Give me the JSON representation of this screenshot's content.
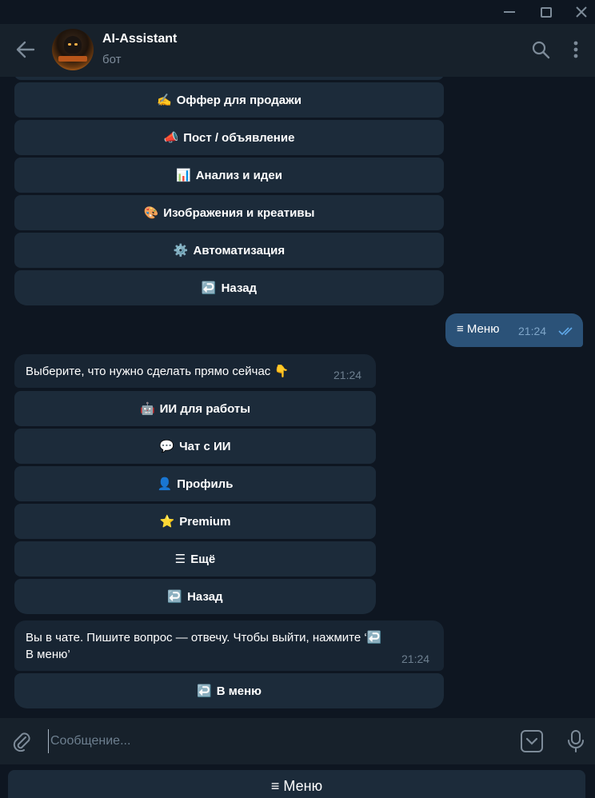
{
  "window": {
    "minimize_label": "—",
    "maximize_label": "☐",
    "close_label": "✕"
  },
  "header": {
    "title": "AI-Assistant",
    "subtitle": "бот"
  },
  "colors": {
    "accent": "#2b5278",
    "bg": "#0e1621",
    "panel": "#17212b",
    "button": "#1c2b3a",
    "read_checks": "#5fa8e8"
  },
  "keyboard_top": [
    {
      "emoji": "✍️",
      "label": "Оффер для продажи"
    },
    {
      "emoji": "📣",
      "label": "Пост / объявление"
    },
    {
      "emoji": "📊",
      "label": "Анализ и идеи"
    },
    {
      "emoji": "🎨",
      "label": "Изображения и креативы"
    },
    {
      "emoji": "⚙️",
      "label": "Автоматизация"
    },
    {
      "emoji": "↩️",
      "label": "Назад"
    }
  ],
  "outgoing": {
    "text": "≡ Меню",
    "time": "21:24"
  },
  "message1": {
    "text": "Выберите, что нужно сделать прямо сейчас 👇",
    "time": "21:24"
  },
  "keyboard_mid": [
    {
      "emoji": "🤖",
      "label": "ИИ для работы"
    },
    {
      "emoji": "💬",
      "label": "Чат с ИИ"
    },
    {
      "emoji": "👤",
      "label": "Профиль"
    },
    {
      "emoji": "⭐",
      "label": "Premium"
    },
    {
      "emoji": "☰",
      "label": "Ещё"
    },
    {
      "emoji": "↩️",
      "label": "Назад"
    }
  ],
  "message2": {
    "line1": "Вы в чате. Пишите вопрос — отвечу. Чтобы выйти, нажмите ‘↩️",
    "line2": "В меню’",
    "time": "21:24"
  },
  "keyboard_bottom": [
    {
      "emoji": "↩️",
      "label": "В меню"
    }
  ],
  "input": {
    "placeholder": "Сообщение...",
    "value": ""
  },
  "menu_button": {
    "label": "≡ Меню"
  }
}
